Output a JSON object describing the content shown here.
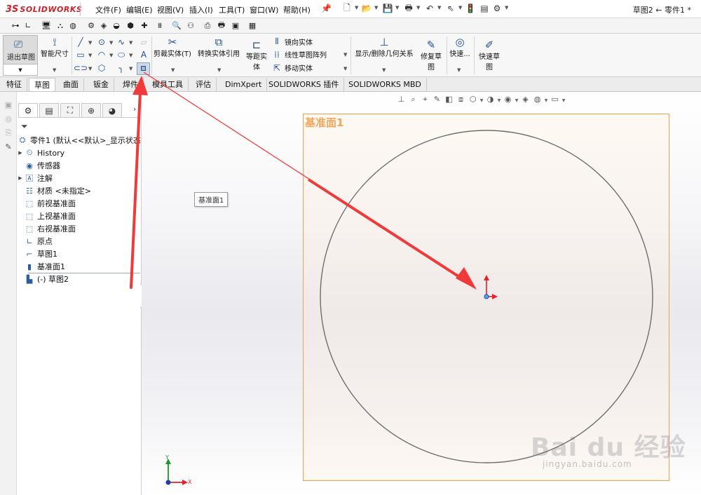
{
  "app": {
    "logo_prefix": "3S",
    "logo_name": "SOLIDWORKS",
    "document_title": "草图2 ← 零件1 *"
  },
  "menu": [
    {
      "label": "文件(F)"
    },
    {
      "label": "编辑(E)"
    },
    {
      "label": "视图(V)"
    },
    {
      "label": "插入(I)"
    },
    {
      "label": "工具(T)"
    },
    {
      "label": "窗口(W)"
    },
    {
      "label": "帮助(H)"
    }
  ],
  "ribbon": {
    "exit_sketch": "退出草图",
    "smart_dimension": "智能尺寸",
    "trim_entities": "剪裁实体(T)",
    "convert_entities": "转换实体引用",
    "offset_entities_1": "等距实",
    "offset_entities_2": "体",
    "mirror_entities": "镜向实体",
    "linear_pattern": "线性草图阵列",
    "move_entities": "移动实体",
    "display_relations": "显示/删除几何关系",
    "repair_sketch_1": "修复草",
    "repair_sketch_2": "图",
    "quick_snaps": "快速...",
    "rapid_sketch_1": "快速草",
    "rapid_sketch_2": "图"
  },
  "tabs": [
    {
      "label": "特征"
    },
    {
      "label": "草图",
      "active": true
    },
    {
      "label": "曲面"
    },
    {
      "label": "钣金"
    },
    {
      "label": "焊件"
    },
    {
      "label": "模具工具"
    },
    {
      "label": "评估"
    },
    {
      "label": "DimXpert"
    },
    {
      "label": "SOLIDWORKS 插件"
    },
    {
      "label": "SOLIDWORKS MBD"
    }
  ],
  "feature_tree": {
    "root": "零件1 (默认<<默认>_显示状态",
    "items": [
      {
        "label": "History",
        "icon": "history-icon",
        "expandable": true
      },
      {
        "label": "传感器",
        "icon": "sensor-icon",
        "expandable": false
      },
      {
        "label": "注解",
        "icon": "annotation-icon",
        "expandable": true
      },
      {
        "label": "材质 <未指定>",
        "icon": "material-icon",
        "expandable": false
      },
      {
        "label": "前视基准面",
        "icon": "plane-icon",
        "expandable": false
      },
      {
        "label": "上视基准面",
        "icon": "plane-icon",
        "expandable": false
      },
      {
        "label": "右视基准面",
        "icon": "plane-icon",
        "expandable": false
      },
      {
        "label": "原点",
        "icon": "origin-icon",
        "expandable": false
      },
      {
        "label": "草图1",
        "icon": "sketch-icon",
        "expandable": false
      },
      {
        "label": "基准面1",
        "icon": "plane-icon",
        "expandable": false
      },
      {
        "label": "(-) 草图2",
        "icon": "sketch-icon",
        "expandable": false
      }
    ]
  },
  "graphics": {
    "plane_label": "基准面1",
    "tooltip": "基准面1",
    "triad_x": "X",
    "triad_y": "Y"
  },
  "watermark": {
    "brand": "Bai du 经验",
    "url": "jingyan.baidu.com"
  },
  "colors": {
    "brand_red": "#d31f26",
    "plane_border": "#f0a050",
    "plane_label": "#f2a65a",
    "annotation_arrow": "#f03a3a",
    "axis_red": "#e8202a",
    "axis_green": "#1a9a2a",
    "axis_blue": "#1c3fa8"
  }
}
